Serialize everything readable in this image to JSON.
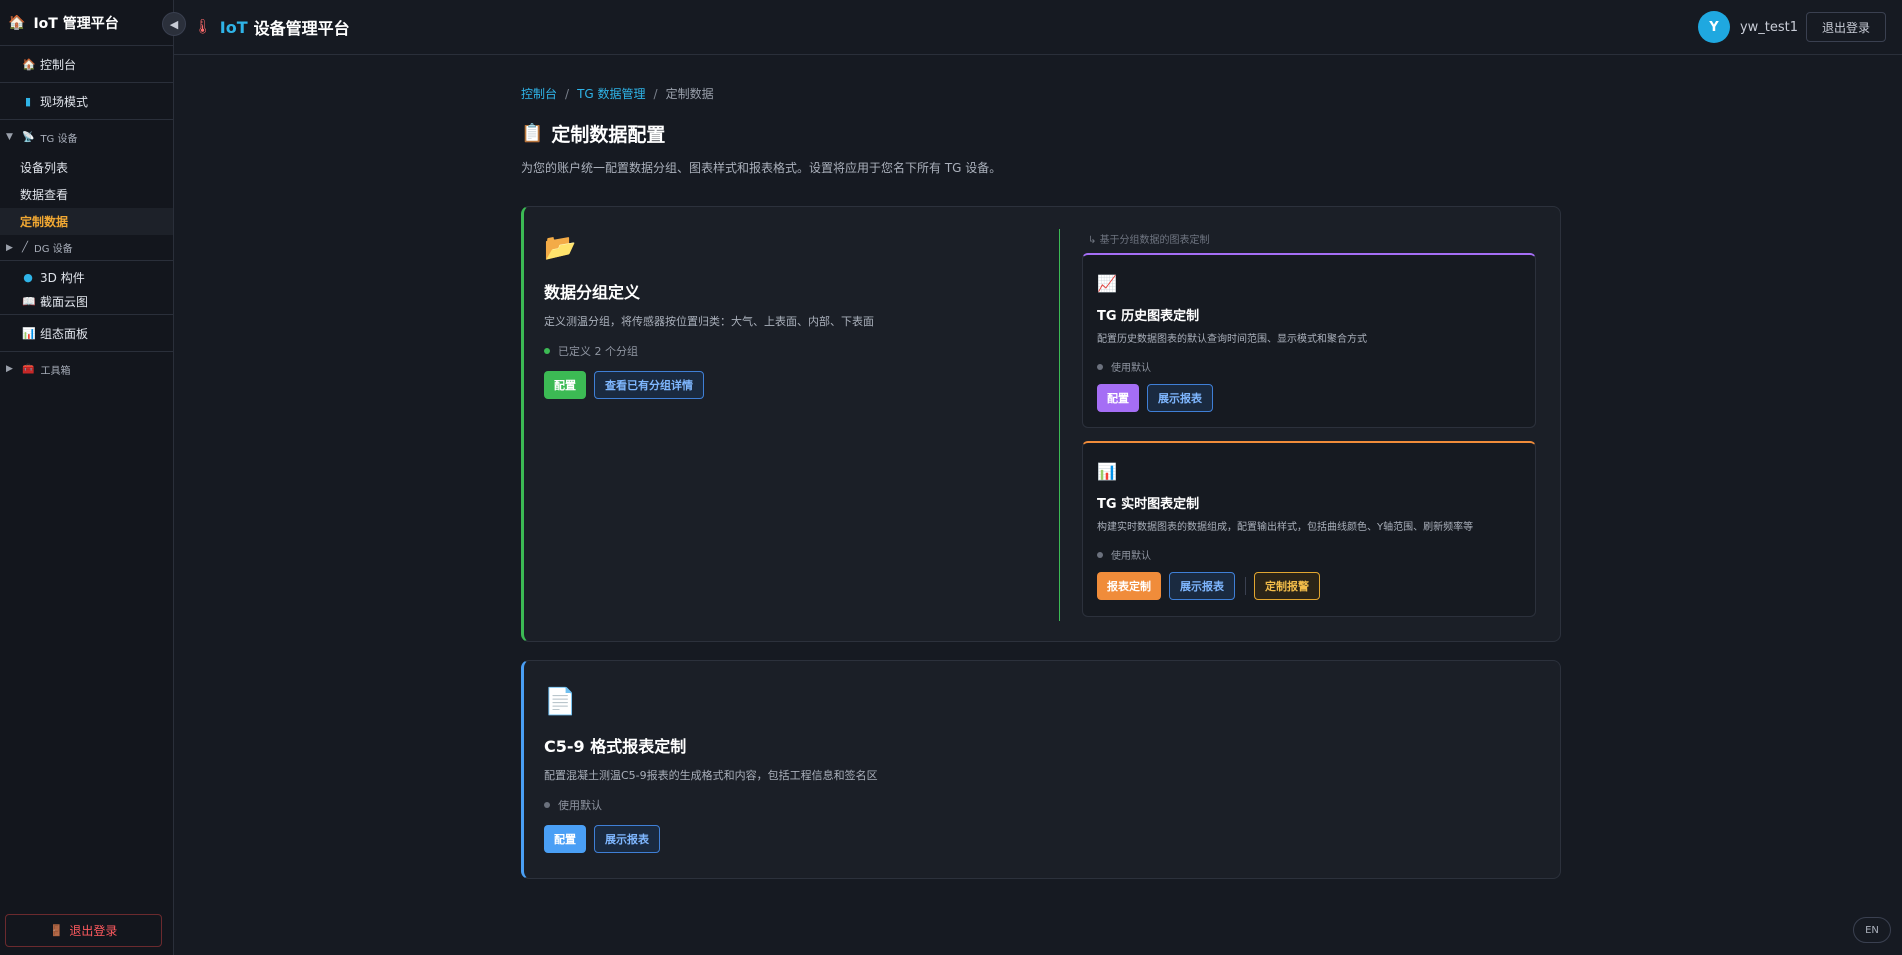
{
  "sidebar": {
    "brand": "IoT 管理平台",
    "collapse_icon": "◀",
    "items": {
      "dashboard": "控制台",
      "field_mode": "现场模式",
      "tg_group": "TG 设备",
      "tg_devices": "设备列表",
      "tg_data_view": "数据查看",
      "tg_custom_data": "定制数据",
      "dg_group": "DG 设备",
      "components_3d": "3D 构件",
      "section_cloud": "截面云图",
      "config_panel": "组态面板",
      "toolbox": "工具箱"
    },
    "logout": "退出登录"
  },
  "header": {
    "iot": "IoT",
    "title": "设备管理平台",
    "avatar_letter": "Y",
    "username": "yw_test1",
    "logout": "退出登录"
  },
  "breadcrumb": {
    "home": "控制台",
    "section": "TG 数据管理",
    "current": "定制数据",
    "sep": "/"
  },
  "page": {
    "title": "定制数据配置",
    "description": "为您的账户统一配置数据分组、图表样式和报表格式。设置将应用于您名下所有 TG 设备。"
  },
  "group_card": {
    "title": "数据分组定义",
    "description": "定义测温分组，将传感器按位置归类：大气、上表面、内部、下表面",
    "status": "已定义 2 个分组",
    "btn_config": "配置",
    "btn_view": "查看已有分组详情"
  },
  "chart_hint": "基于分组数据的图表定制",
  "history_card": {
    "title": "TG 历史图表定制",
    "description": "配置历史数据图表的默认查询时间范围、显示模式和聚合方式",
    "status": "使用默认",
    "btn_config": "配置",
    "btn_report": "展示报表"
  },
  "realtime_card": {
    "title": "TG 实时图表定制",
    "description": "构建实时数据图表的数据组成，配置输出样式，包括曲线颜色、Y轴范围、刷新频率等",
    "status": "使用默认",
    "btn_custom": "报表定制",
    "btn_report": "展示报表",
    "btn_alarm": "定制报警"
  },
  "c59_card": {
    "title": "C5-9 格式报表定制",
    "description": "配置混凝土测温C5-9报表的生成格式和内容，包括工程信息和签名区",
    "status": "使用默认",
    "btn_config": "配置",
    "btn_report": "展示报表"
  },
  "lang": "EN",
  "colors": {
    "accent_blue": "#2fb4e8",
    "active_orange": "#f0a732",
    "green": "#3cba54",
    "purple": "#a56ef5",
    "orange": "#f08c3a",
    "blue": "#4a9ff5"
  }
}
